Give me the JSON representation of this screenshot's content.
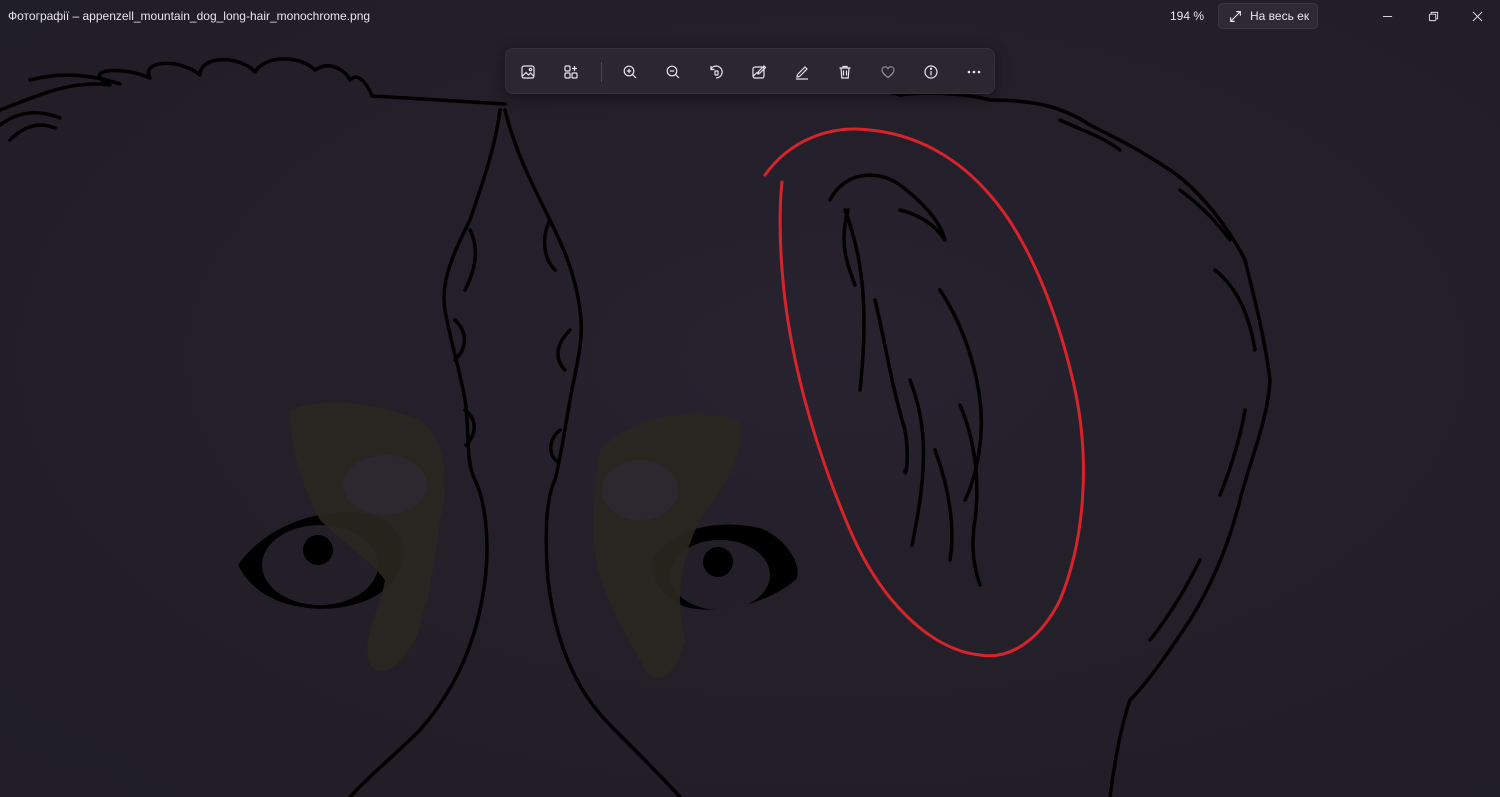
{
  "window": {
    "title": "Фотографії – appenzell_mountain_dog_long-hair_monochrome.png",
    "zoom_level": "194 %",
    "fullscreen_label": "На весь ек"
  },
  "window_controls": [
    {
      "name": "minimize",
      "icon": "minimize-icon"
    },
    {
      "name": "restore",
      "icon": "restore-icon"
    },
    {
      "name": "close",
      "icon": "close-icon"
    }
  ],
  "toolbar": {
    "buttons": [
      {
        "name": "view-original",
        "icon": "image-icon"
      },
      {
        "name": "add-to-album",
        "icon": "grid-add-icon"
      },
      {
        "name": "zoom-in",
        "icon": "zoom-in-icon"
      },
      {
        "name": "zoom-out",
        "icon": "zoom-out-icon"
      },
      {
        "name": "rotate",
        "icon": "rotate-icon"
      },
      {
        "name": "edit-image",
        "icon": "edit-image-icon"
      },
      {
        "name": "draw",
        "icon": "pen-icon"
      },
      {
        "name": "delete",
        "icon": "trash-icon"
      },
      {
        "name": "favorite",
        "icon": "heart-icon"
      },
      {
        "name": "info",
        "icon": "info-icon"
      },
      {
        "name": "more",
        "icon": "more-icon"
      }
    ]
  },
  "colors": {
    "background": "#221f28",
    "annotation_stroke": "#d9232b",
    "lineart_stroke": "#000000"
  }
}
